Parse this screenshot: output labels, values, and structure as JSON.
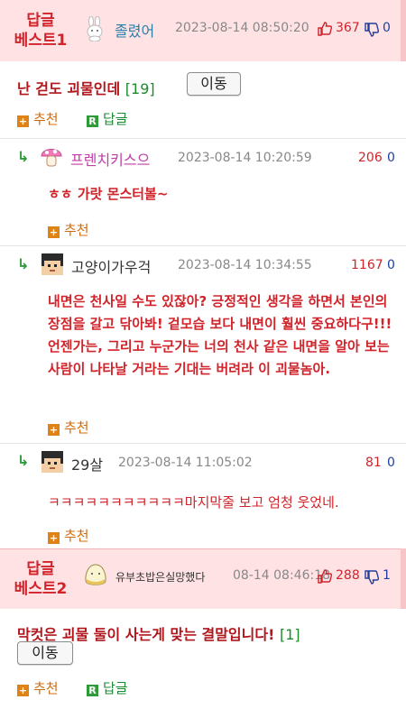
{
  "best1": {
    "tag_line1": "답글",
    "tag_line2": "베스트1",
    "nickname": "졸렸어",
    "date": "2023-08-14 08:50:20",
    "up": "367",
    "down": "0",
    "title": "난 걷도 괴물인데",
    "count": "[19]",
    "move_label": "이동",
    "recommend_label": "추천",
    "reply_label": "답글"
  },
  "comments": [
    {
      "nickname": "프렌치키스으",
      "date": "2023-08-14 10:20:59",
      "up": "206",
      "down": "0",
      "text": "ㅎㅎ 가랏 몬스터볼~",
      "recommend_label": "추천"
    },
    {
      "nickname": "고양이가우걱",
      "date": "2023-08-14 10:34:55",
      "up": "1167",
      "down": "0",
      "text": "내면은 천사일 수도 있잖아? 긍정적인 생각을 하면서 본인의 장점을 갈고 닦아봐! 겉모습 보다 내면이 훨씬 중요하다구!!! 언젠가는, 그리고 누군가는 너의 천사 같은 내면을 알아 보는 사람이 나타날 거라는 기대는 버려라 이 괴물놈아.",
      "recommend_label": "추천"
    },
    {
      "nickname": "29살",
      "date": "2023-08-14 11:05:02",
      "up": "81",
      "down": "0",
      "text": "ㅋㅋㅋㅋㅋㅋㅋㅋㅋㅋㅋ마지막줄 보고 엄청 웃었네.",
      "recommend_label": "추천"
    }
  ],
  "best2": {
    "tag_line1": "답글",
    "tag_line2": "베스트2",
    "nickname": "유부초밥은실망했다",
    "date": "08-14 08:46:18",
    "up": "288",
    "down": "1",
    "title": "막컷은 괴물 둘이 사는게 맞는 결말입니다!",
    "count": "[1]",
    "move_label": "이동",
    "recommend_label": "추천",
    "reply_label": "답글"
  },
  "icons": {
    "reply_arrow": "reply-arrow-icon",
    "thumb_up": "thumbs-up-icon",
    "thumb_down": "thumbs-down-icon",
    "recommend": "plus-square-icon",
    "reply": "r-square-icon"
  },
  "colors": {
    "best_band": "#ffe2e4",
    "accent_red": "#d0232a",
    "down_blue": "#1f3f9c",
    "reply_green": "#1d8a34",
    "recommend_orange": "#d06c10"
  }
}
